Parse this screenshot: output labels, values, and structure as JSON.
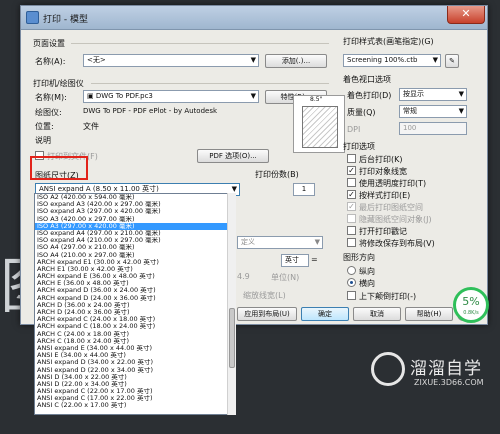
{
  "window": {
    "title": "打印 - 模型"
  },
  "page_setup": {
    "group_label": "页面设置",
    "name_label": "名称(A):",
    "name_value": "<无>",
    "add_button": "添加(.)..."
  },
  "printer": {
    "group_label": "打印机/绘图仪",
    "name_label": "名称(M):",
    "name_value": "DWG To PDF.pc3",
    "properties_button": "特性(R)...",
    "plotter_label": "绘图仪:",
    "plotter_value": "DWG To PDF - PDF ePlot - by Autodesk",
    "location_label": "位置:",
    "location_value": "文件",
    "desc_label": "说明",
    "print_to_file": "打印到文件(F)",
    "pdf_options_button": "PDF 选项(O)...",
    "preview_dim": "8.5\""
  },
  "paper": {
    "label": "图纸尺寸(Z)",
    "selected": "ANSI expand A (8.50 x 11.00 英寸)",
    "options": [
      "ISO A2 (420.00 x 594.00 毫米)",
      "ISO expand A3 (420.00 x 297.00 毫米)",
      "ISO expand A3 (297.00 x 420.00 毫米)",
      "ISO A3 (420.00 x 297.00 毫米)",
      "ISO A3 (297.00 x 420.00 毫米)",
      "ISO expand A4 (297.00 x 210.00 毫米)",
      "ISO expand A4 (210.00 x 297.00 毫米)",
      "ISO A4 (297.00 x 210.00 毫米)",
      "ISO A4 (210.00 x 297.00 毫米)",
      "ARCH expand E1 (30.00 x 42.00 英寸)",
      "ARCH E1 (30.00 x 42.00 英寸)",
      "ARCH expand E (36.00 x 48.00 英寸)",
      "ARCH E (36.00 x 48.00 英寸)",
      "ARCH expand D (36.00 x 24.00 英寸)",
      "ARCH expand D (24.00 x 36.00 英寸)",
      "ARCH D (36.00 x 24.00 英寸)",
      "ARCH D (24.00 x 36.00 英寸)",
      "ARCH expand C (24.00 x 18.00 英寸)",
      "ARCH expand C (18.00 x 24.00 英寸)",
      "ARCH C (24.00 x 18.00 英寸)",
      "ARCH C (18.00 x 24.00 英寸)",
      "ANSI expand E (34.00 x 44.00 英寸)",
      "ANSI E (34.00 x 44.00 英寸)",
      "ANSI expand D (34.00 x 22.00 英寸)",
      "ANSI expand D (22.00 x 34.00 英寸)",
      "ANSI D (34.00 x 22.00 英寸)",
      "ANSI D (22.00 x 34.00 英寸)",
      "ANSI expand C (22.00 x 17.00 英寸)",
      "ANSI expand C (17.00 x 22.00 英寸)",
      "ANSI C (22.00 x 17.00 英寸)"
    ],
    "highlighted_index": 4
  },
  "copies": {
    "label": "打印份数(B)",
    "value": "1"
  },
  "partial_behind": {
    "custom": "定义",
    "unit_combo": "英寸",
    "equals": "=",
    "value": "4.9",
    "unit_label": "单位(N)",
    "scale_lineweights": "缩放线宽(L)"
  },
  "style_table": {
    "group_label": "打印样式表(画笔指定)(G)",
    "value": "Screening 100%.ctb"
  },
  "viewport": {
    "group_label": "着色视口选项",
    "shade_label": "着色打印(D)",
    "shade_value": "按显示",
    "quality_label": "质量(Q)",
    "quality_value": "常规",
    "dpi_label": "DPI",
    "dpi_value": "100"
  },
  "options": {
    "group_label": "打印选项",
    "items": [
      {
        "label": "后台打印(K)",
        "checked": false,
        "disabled": false
      },
      {
        "label": "打印对象线宽",
        "checked": true,
        "disabled": false
      },
      {
        "label": "使用透明度打印(T)",
        "checked": false,
        "disabled": false
      },
      {
        "label": "按样式打印(E)",
        "checked": true,
        "disabled": false
      },
      {
        "label": "最后打印图纸空间",
        "checked": true,
        "disabled": true
      },
      {
        "label": "隐藏图纸空间对象(J)",
        "checked": false,
        "disabled": true
      },
      {
        "label": "打开打印戳记",
        "checked": false,
        "disabled": false
      },
      {
        "label": "将修改保存到布局(V)",
        "checked": false,
        "disabled": false
      }
    ]
  },
  "orientation": {
    "group_label": "图形方向",
    "portrait": "纵向",
    "landscape": "横向",
    "upside_down": "上下颠倒打印(-)"
  },
  "buttons": {
    "apply": "应用到布局(U)",
    "ok": "确定",
    "cancel": "取消",
    "help": "帮助(H)"
  },
  "gauge": {
    "value": "5%",
    "sub": "0.8K/s"
  },
  "watermark": {
    "title": "溜溜自学",
    "subtitle": "ZIXUE.3D66.COM"
  },
  "background": {
    "glyph": "图"
  }
}
